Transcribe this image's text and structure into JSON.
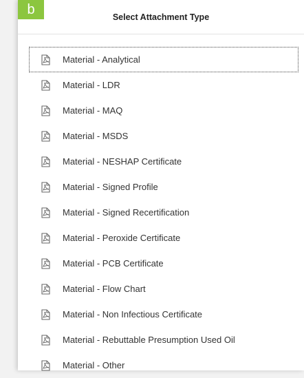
{
  "badge": {
    "letter": "b",
    "color": "#8cc63f"
  },
  "header": {
    "title": "Select Attachment Type"
  },
  "icon_name": "pdf-file-icon",
  "items": [
    {
      "label": "Material - Analytical",
      "focused": true
    },
    {
      "label": "Material - LDR"
    },
    {
      "label": "Material - MAQ"
    },
    {
      "label": "Material - MSDS"
    },
    {
      "label": "Material - NESHAP Certificate"
    },
    {
      "label": "Material - Signed Profile"
    },
    {
      "label": "Material - Signed Recertification"
    },
    {
      "label": "Material - Peroxide Certificate"
    },
    {
      "label": "Material - PCB Certificate"
    },
    {
      "label": "Material - Flow Chart"
    },
    {
      "label": "Material - Non Infectious Certificate"
    },
    {
      "label": "Material - Rebuttable Presumption Used Oil"
    },
    {
      "label": "Material - Other"
    }
  ]
}
